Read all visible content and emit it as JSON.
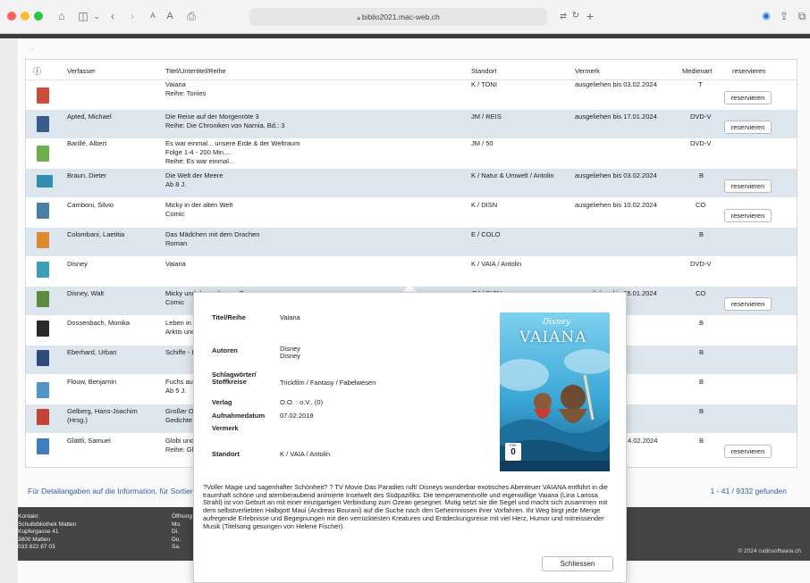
{
  "browser": {
    "url": "biblio2021.mac-web.ch"
  },
  "colors": {
    "row_alt": "#dde5ee",
    "link": "#2b5ea8",
    "footer_bg": "#444444"
  },
  "table": {
    "headers": {
      "info": "ⓘ",
      "author": "Verfasser",
      "title": "Titel/Untertitel/Reihe",
      "location": "Standort",
      "note": "Vermerk",
      "media": "Medienart",
      "reserve": "reservieren"
    },
    "rows": [
      {
        "author": "",
        "title": [
          "Vaiana",
          "Reihe: Tonies"
        ],
        "location": "K / TONI",
        "note": "ausgeliehen bis 03.02.2024",
        "media": "T",
        "button": "reservieren",
        "thumb": "#c94d3b"
      },
      {
        "author": "Apted, Michael",
        "title": [
          "Die Reise auf der Morgenröte 3",
          "Reihe: Die Chroniken von Narnia, Bd.: 3"
        ],
        "location": "JM / REIS",
        "note": "ausgeliehen bis 17.01.2024",
        "media": "DVD-V",
        "button": "reservieren",
        "thumb": "#3a5e8c"
      },
      {
        "author": "Barillé, Albert",
        "title": [
          "Es war einmal... unsere Erde & der Weltraum",
          "Folge 1-4 - 200 Min....",
          "Reihe: Es war einmal..."
        ],
        "location": "JM / 50",
        "note": "",
        "media": "DVD-V",
        "button": "",
        "thumb": "#6fae4c"
      },
      {
        "author": "Braun, Dieter",
        "title": [
          "Die Welt der Meere",
          "Ab 8 J."
        ],
        "location": "K / Natur & Umwelt / Antolin",
        "note": "ausgeliehen bis 03.02.2024",
        "media": "B",
        "button": "reservieren",
        "thumb": "#2f8fb0"
      },
      {
        "author": "Camboni, Silvio",
        "title": [
          "Micky in der alten Welt",
          "Comic"
        ],
        "location": "K / DISN",
        "note": "ausgeliehen bis 10.02.2024",
        "media": "CO",
        "button": "reservieren",
        "thumb": "#4a7fa8"
      },
      {
        "author": "Colombani, Laetitia",
        "title": [
          "Das Mädchen mit dem Drachen",
          "Roman"
        ],
        "location": "E / COLO",
        "note": "",
        "media": "B",
        "button": "",
        "thumb": "#e08a2e"
      },
      {
        "author": "Disney",
        "title": [
          "Vaiana"
        ],
        "location": "K / VAIA / Antolin",
        "note": "",
        "media": "DVD-V",
        "button": "",
        "thumb": "#3a9fb8"
      },
      {
        "author": "Disney, Walt",
        "title": [
          "Micky und der verlorene Ozean",
          "Comic"
        ],
        "location": "JM / DISN",
        "note": "ausgeliehen bis 25.01.2024",
        "media": "CO",
        "button": "reservieren",
        "thumb": "#5a8a3c"
      },
      {
        "author": "Dossenbach, Monika",
        "title": [
          "Leben in d",
          "Arktis und"
        ],
        "location": "",
        "note": "",
        "media": "B",
        "button": "",
        "thumb": "#2a2a2a"
      },
      {
        "author": "Eberhard, Urban",
        "title": [
          "Schiffe - I"
        ],
        "location": "",
        "note": "",
        "media": "B",
        "button": "",
        "thumb": "#2d4e7a"
      },
      {
        "author": "Flouw, Benjamin",
        "title": [
          "Fuchs auf",
          "Ab 5 J."
        ],
        "location": "",
        "note": "",
        "media": "B",
        "button": "",
        "thumb": "#4f95c9"
      },
      {
        "author": "Gelberg, Hans-Joachim",
        "author2": "(Hrsg.)",
        "title": [
          "Großer O",
          "Gedichte"
        ],
        "location": "",
        "note": "",
        "media": "B",
        "button": "",
        "thumb": "#c5423a"
      },
      {
        "author": "Glättli, Samuel",
        "title": [
          "Globi und",
          "Reihe: Gl"
        ],
        "location": "",
        "note": "4.02.2024",
        "media": "B",
        "button": "reservieren",
        "thumb": "#3f7fc0"
      }
    ]
  },
  "info_line": "Für Detailangaben auf die Information, für Sortier",
  "count_line": "1 - 41 / 9332 gefunden",
  "footer": {
    "contact": [
      "Kontakt:",
      "Schulbibliothek Matten",
      "Kupfergasse 41",
      "3800 Matten",
      "033 822 87 03"
    ],
    "hours": [
      "Öffnung",
      "Mo.",
      "Di.",
      "Do.",
      "Sa."
    ],
    "copyright": "© 2024 rudinsoftware.ch"
  },
  "popup": {
    "title_label": "Titel/Reihe",
    "title_value": "Vaiana",
    "authors_label": "Autoren",
    "authors_value": [
      "Disney",
      "Disney"
    ],
    "keywords_label": [
      "Schlagwörter/",
      "Stoffkreise"
    ],
    "keywords_value": "Trickfilm / Fantasy / Fabelwesen",
    "publisher_label": "Verlag",
    "publisher_value": "O.O. : o.V., (0)",
    "recorded_label": "Aufnahmedatum",
    "recorded_value": "07.02.2018",
    "note_label": "Vermerk",
    "location_label": "Standort",
    "location_value": "K / VAIA / Antolin",
    "poster_brand": "Disney",
    "poster_title": "VAIANA",
    "poster_fsk": "0",
    "poster_fsk_label": "FSK",
    "description": "?Voller Magie und sagenhafter Schönheit? ? TV Movie Das Paradies ruft! Disneys wunderbar exotisches Abenteuer VAIANA entführt in die traumhaft schöne und atemberaubend animierte Inselwelt des Südpazifiks. Die temperamentvolle und eigenwillige Vaiana (Lina Larissa Strahl) ist von Geburt an mit einer einzigartigen Verbindung zum Ozean gesegnet. Mutig setzt sie die Segel und macht sich zusammen mit dem selbstverliebten Halbgott Maui (Andreas Bourani) auf die Suche nach den Geheimnissen ihrer Vorfahren. Ihr Weg birgt jede Menge aufregende Erlebnisse und Begegnungen mit den verrücktesten Kreaturen und Entdeckungsreise mit viel Herz, Humor und mitreissender Musik (Titelsong gesungen von Helene Fischer).",
    "close_label": "Schliessen"
  }
}
